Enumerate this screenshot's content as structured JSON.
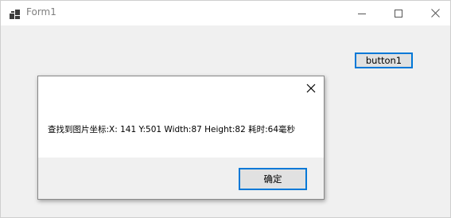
{
  "window": {
    "title": "Form1",
    "icons": {
      "app": "app-icon",
      "minimize": "minimize-icon",
      "maximize": "maximize-icon",
      "close": "close-icon"
    }
  },
  "form": {
    "button_label": "button1"
  },
  "message_box": {
    "text": "查找到图片坐标:X: 141 Y:501 Width:87 Height:82 耗时:64毫秒",
    "ok_label": "确定",
    "close_icon": "close-icon"
  },
  "colors": {
    "accent": "#0078d7",
    "button_face": "#e1e1e1",
    "form_background": "#f0f0f0"
  }
}
